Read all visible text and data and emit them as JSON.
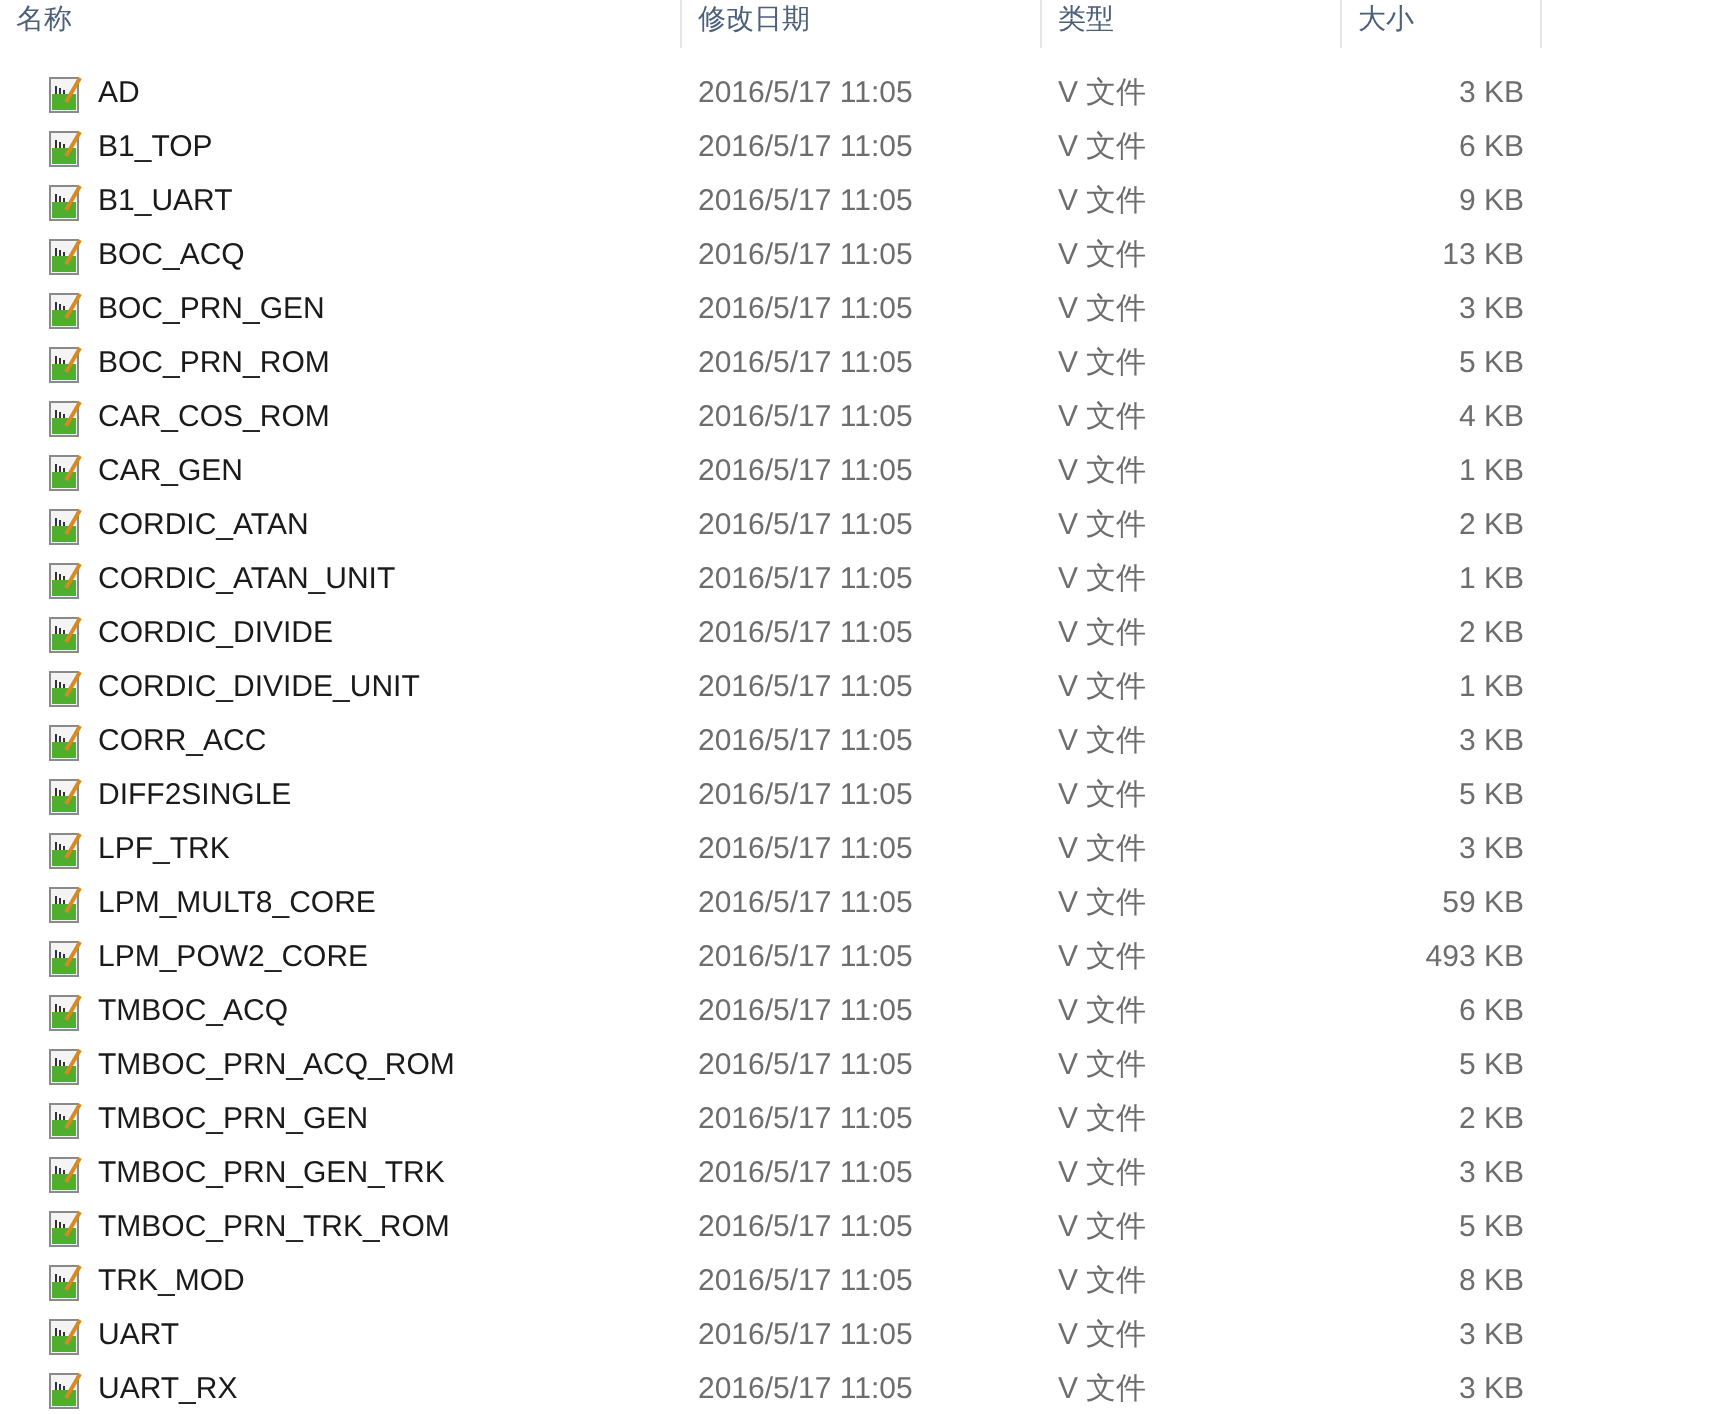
{
  "columns": [
    "名称",
    "修改日期",
    "类型",
    "大小"
  ],
  "files": [
    {
      "name": "AD",
      "modified": "2016/5/17 11:05",
      "type": "V 文件",
      "size": "3 KB"
    },
    {
      "name": "B1_TOP",
      "modified": "2016/5/17 11:05",
      "type": "V 文件",
      "size": "6 KB"
    },
    {
      "name": "B1_UART",
      "modified": "2016/5/17 11:05",
      "type": "V 文件",
      "size": "9 KB"
    },
    {
      "name": "BOC_ACQ",
      "modified": "2016/5/17 11:05",
      "type": "V 文件",
      "size": "13 KB"
    },
    {
      "name": "BOC_PRN_GEN",
      "modified": "2016/5/17 11:05",
      "type": "V 文件",
      "size": "3 KB"
    },
    {
      "name": "BOC_PRN_ROM",
      "modified": "2016/5/17 11:05",
      "type": "V 文件",
      "size": "5 KB"
    },
    {
      "name": "CAR_COS_ROM",
      "modified": "2016/5/17 11:05",
      "type": "V 文件",
      "size": "4 KB"
    },
    {
      "name": "CAR_GEN",
      "modified": "2016/5/17 11:05",
      "type": "V 文件",
      "size": "1 KB"
    },
    {
      "name": "CORDIC_ATAN",
      "modified": "2016/5/17 11:05",
      "type": "V 文件",
      "size": "2 KB"
    },
    {
      "name": "CORDIC_ATAN_UNIT",
      "modified": "2016/5/17 11:05",
      "type": "V 文件",
      "size": "1 KB"
    },
    {
      "name": "CORDIC_DIVIDE",
      "modified": "2016/5/17 11:05",
      "type": "V 文件",
      "size": "2 KB"
    },
    {
      "name": "CORDIC_DIVIDE_UNIT",
      "modified": "2016/5/17 11:05",
      "type": "V 文件",
      "size": "1 KB"
    },
    {
      "name": "CORR_ACC",
      "modified": "2016/5/17 11:05",
      "type": "V 文件",
      "size": "3 KB"
    },
    {
      "name": "DIFF2SINGLE",
      "modified": "2016/5/17 11:05",
      "type": "V 文件",
      "size": "5 KB"
    },
    {
      "name": "LPF_TRK",
      "modified": "2016/5/17 11:05",
      "type": "V 文件",
      "size": "3 KB"
    },
    {
      "name": "LPM_MULT8_CORE",
      "modified": "2016/5/17 11:05",
      "type": "V 文件",
      "size": "59 KB"
    },
    {
      "name": "LPM_POW2_CORE",
      "modified": "2016/5/17 11:05",
      "type": "V 文件",
      "size": "493 KB"
    },
    {
      "name": "TMBOC_ACQ",
      "modified": "2016/5/17 11:05",
      "type": "V 文件",
      "size": "6 KB"
    },
    {
      "name": "TMBOC_PRN_ACQ_ROM",
      "modified": "2016/5/17 11:05",
      "type": "V 文件",
      "size": "5 KB"
    },
    {
      "name": "TMBOC_PRN_GEN",
      "modified": "2016/5/17 11:05",
      "type": "V 文件",
      "size": "2 KB"
    },
    {
      "name": "TMBOC_PRN_GEN_TRK",
      "modified": "2016/5/17 11:05",
      "type": "V 文件",
      "size": "3 KB"
    },
    {
      "name": "TMBOC_PRN_TRK_ROM",
      "modified": "2016/5/17 11:05",
      "type": "V 文件",
      "size": "5 KB"
    },
    {
      "name": "TRK_MOD",
      "modified": "2016/5/17 11:05",
      "type": "V 文件",
      "size": "8 KB"
    },
    {
      "name": "UART",
      "modified": "2016/5/17 11:05",
      "type": "V 文件",
      "size": "3 KB"
    },
    {
      "name": "UART_RX",
      "modified": "2016/5/17 11:05",
      "type": "V 文件",
      "size": "3 KB"
    }
  ]
}
